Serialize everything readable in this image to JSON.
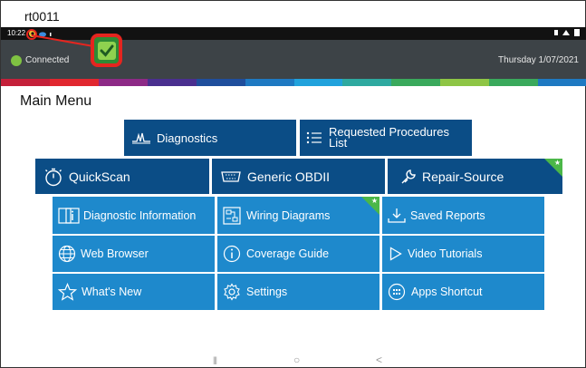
{
  "doc_label": "rt0011",
  "status_bar": {
    "time": "10:22",
    "left_icons": [
      "gear-icon",
      "cloud-icon",
      "download-icon"
    ],
    "right_icons": [
      "notification-icon",
      "wifi-icon",
      "battery-icon"
    ]
  },
  "header": {
    "connection_status": "Connected",
    "connection_color": "#7fc242",
    "date": "Thursday 1/07/2021",
    "background": "#3d4347"
  },
  "highlight_color": "#e5251f",
  "stripe_colors": [
    "#c4203a",
    "#e1272f",
    "#8d2a86",
    "#4a2f8f",
    "#1f4e9c",
    "#1e79c2",
    "#21a2dc",
    "#2ea9a0",
    "#3aa95c",
    "#8ec545",
    "#3aa95c",
    "#1e79c2"
  ],
  "main_menu": {
    "title": "Main Menu",
    "row1": [
      {
        "label": "Diagnostics",
        "icon": "diagnostics-waveform-icon"
      },
      {
        "label_line1": "Requested Procedures",
        "label_line2": "List",
        "icon": "list-icon"
      }
    ],
    "row2": [
      {
        "label": "QuickScan",
        "icon": "stopwatch-icon"
      },
      {
        "label": "Generic OBDII",
        "icon": "obd-connector-icon"
      },
      {
        "label": "Repair-Source",
        "icon": "wrench-icon",
        "badge": "star"
      }
    ],
    "grid": [
      {
        "label": "Diagnostic Information",
        "icon": "info-doc-icon"
      },
      {
        "label": "Wiring Diagrams",
        "icon": "wiring-icon",
        "badge": "star"
      },
      {
        "label": "Saved Reports",
        "icon": "download-tray-icon"
      },
      {
        "label": "Web Browser",
        "icon": "globe-icon"
      },
      {
        "label": "Coverage Guide",
        "icon": "info-circle-icon"
      },
      {
        "label": "Video Tutorials",
        "icon": "play-icon"
      },
      {
        "label": "What's New",
        "icon": "star-outline-icon"
      },
      {
        "label": "Settings",
        "icon": "gear-icon"
      },
      {
        "label": "Apps Shortcut",
        "icon": "apps-icon"
      }
    ],
    "colors": {
      "dark_tile": "#0b4d86",
      "light_tile": "#1e89cc",
      "badge": "#4bb748"
    }
  },
  "nav_bar": {
    "recent": "|||",
    "home": "○",
    "back": "<"
  }
}
